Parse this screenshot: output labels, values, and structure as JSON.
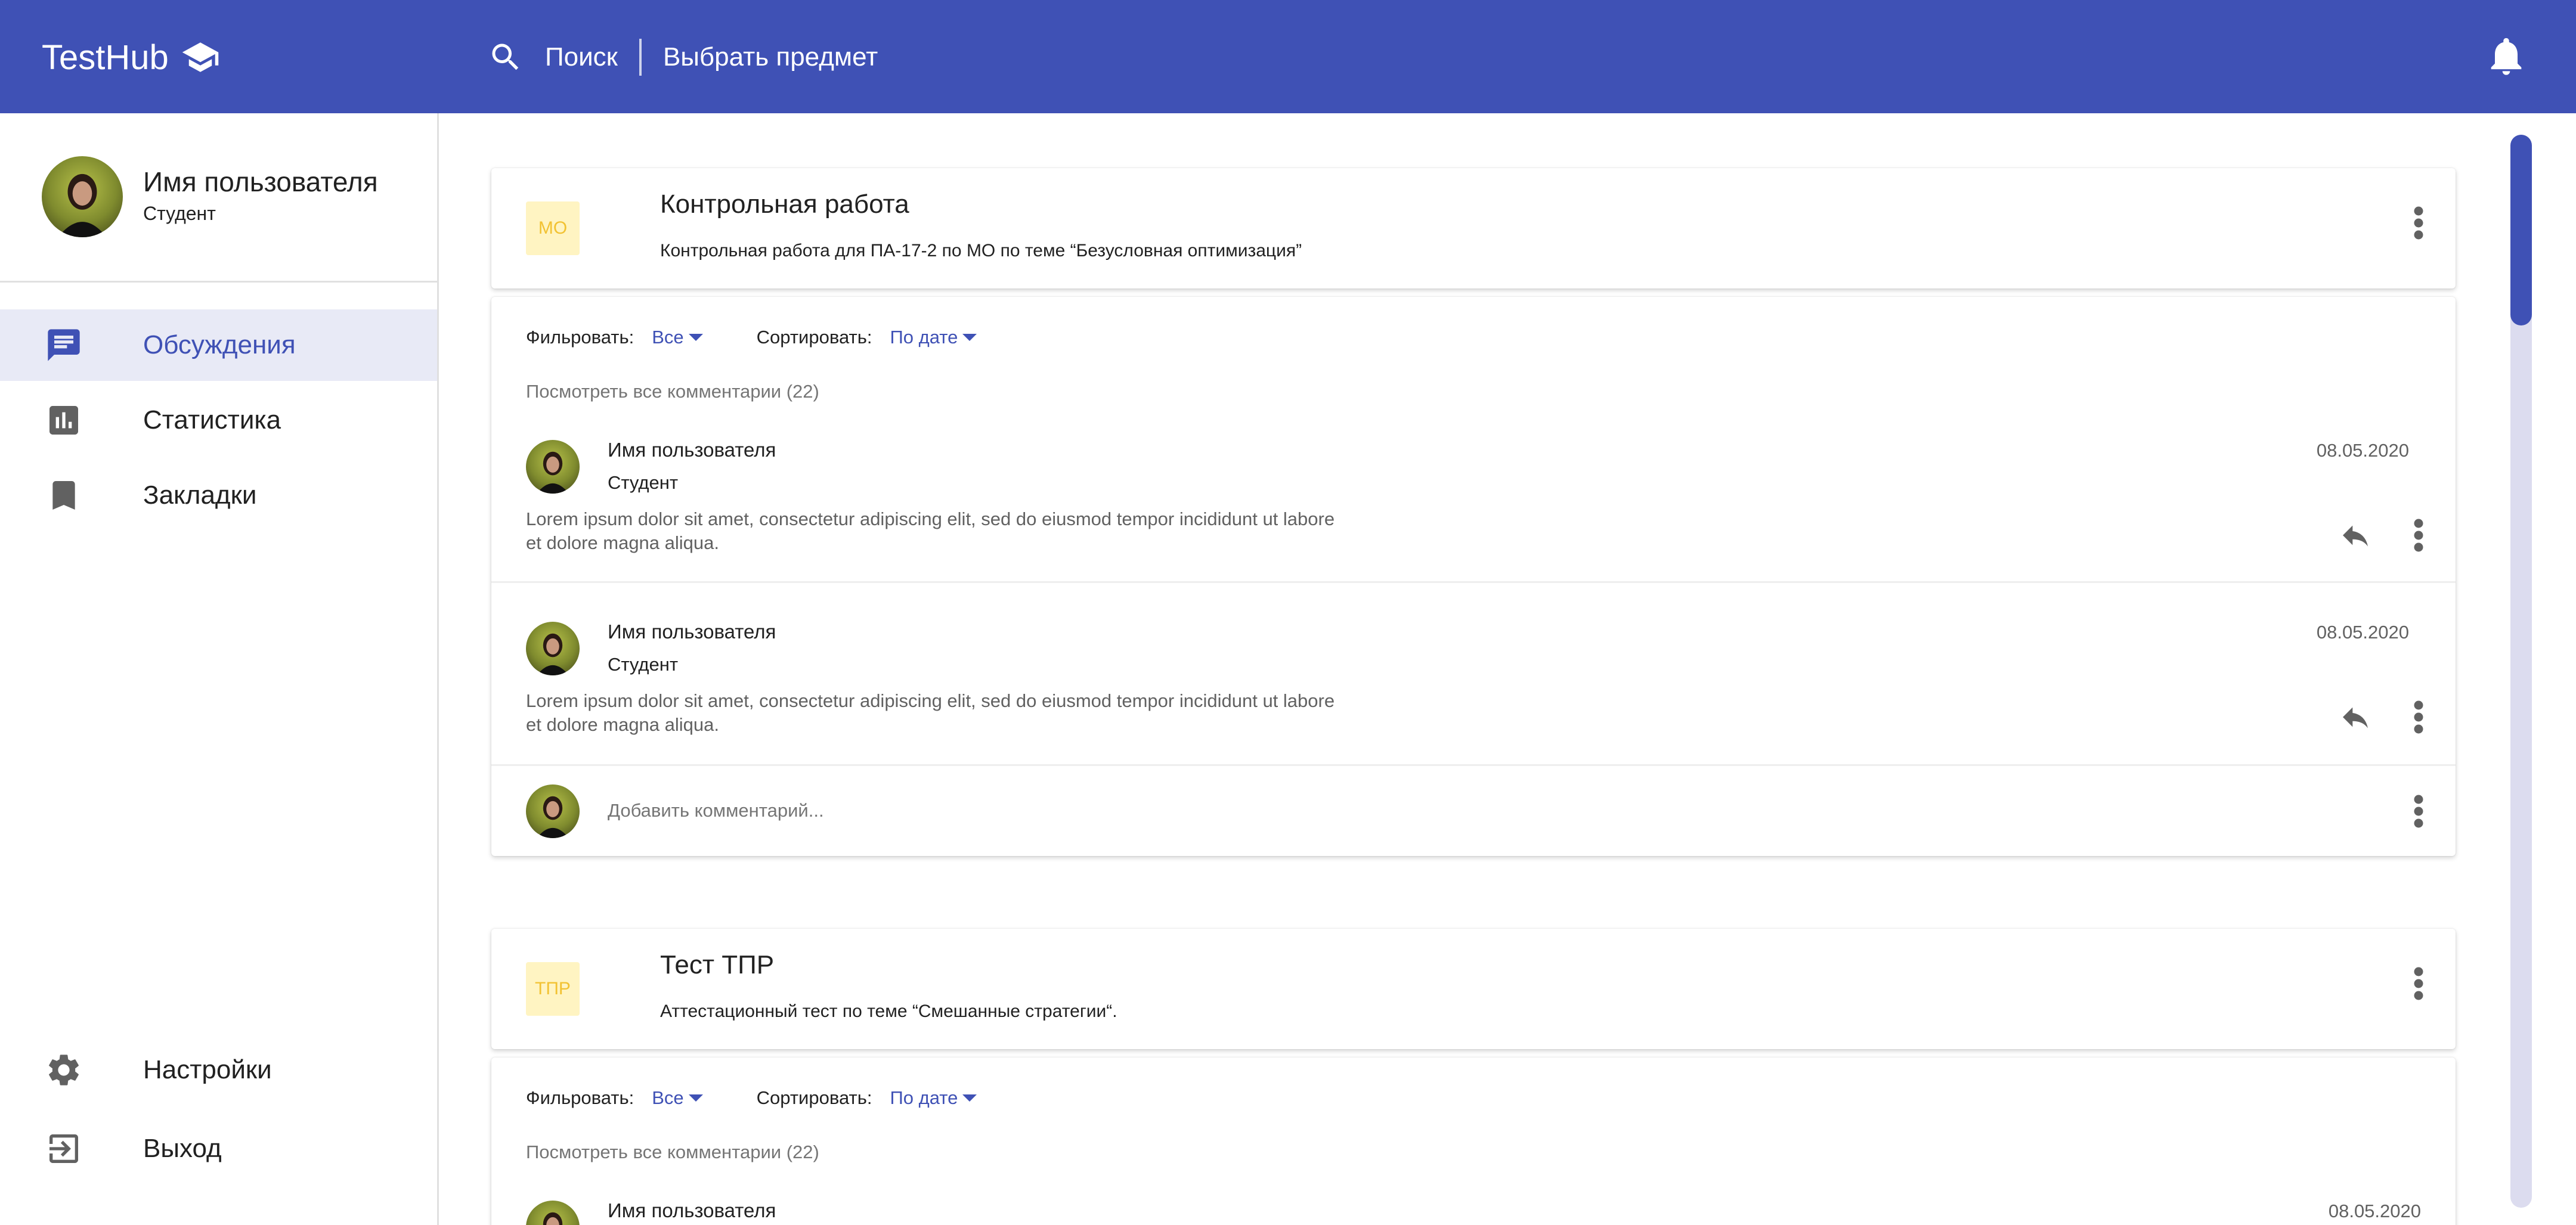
{
  "app": {
    "title": "TestHub"
  },
  "topbar": {
    "search_label": "Поиск",
    "subject_select": "Выбрать предмет"
  },
  "colors": {
    "primary": "#3f51b5",
    "badge_bg": "#fff4c2",
    "badge_text": "#f2c232",
    "active_nav_bg": "#e8eaf6"
  },
  "sidebar": {
    "profile": {
      "name": "Имя пользователя",
      "role": "Студент"
    },
    "items": [
      {
        "label": "Обсуждения",
        "icon": "chat-icon",
        "active": true
      },
      {
        "label": "Статистика",
        "icon": "bar-chart-icon",
        "active": false
      },
      {
        "label": "Закладки",
        "icon": "bookmark-icon",
        "active": false
      }
    ],
    "bottom_items": [
      {
        "label": "Настройки",
        "icon": "gear-icon"
      },
      {
        "label": "Выход",
        "icon": "exit-icon"
      }
    ]
  },
  "posts": [
    {
      "badge": "МО",
      "title": "Контрольная работа",
      "description": "Контрольная работа для ПА-17-2 по МО по теме “Безусловная оптимизация”",
      "filter_label": "Фильровать:",
      "filter_value": "Все",
      "sort_label": "Сортировать:",
      "sort_value": "По дате",
      "view_all": "Посмотреть все комментарии (22)",
      "comments": [
        {
          "name": "Имя пользователя",
          "role": "Студент",
          "date": "08.05.2020",
          "text": "Lorem ipsum dolor sit amet, consectetur adipiscing elit, sed do eiusmod tempor incididunt ut labore et dolore magna aliqua."
        },
        {
          "name": "Имя пользователя",
          "role": "Студент",
          "date": "08.05.2020",
          "text": "Lorem ipsum dolor sit amet, consectetur adipiscing elit, sed do eiusmod tempor incididunt ut labore et dolore magna aliqua."
        }
      ],
      "add_comment_placeholder": "Добавить комментарий..."
    },
    {
      "badge": "ТПР",
      "title": "Тест ТПР",
      "description": "Аттестационный тест по теме “Смешанные стратегии“.",
      "filter_label": "Фильровать:",
      "filter_value": "Все",
      "sort_label": "Сортировать:",
      "sort_value": "По дате",
      "view_all": "Посмотреть все комментарии (22)",
      "comments": [
        {
          "name": "Имя пользователя",
          "date": "08.05.2020"
        }
      ]
    }
  ]
}
